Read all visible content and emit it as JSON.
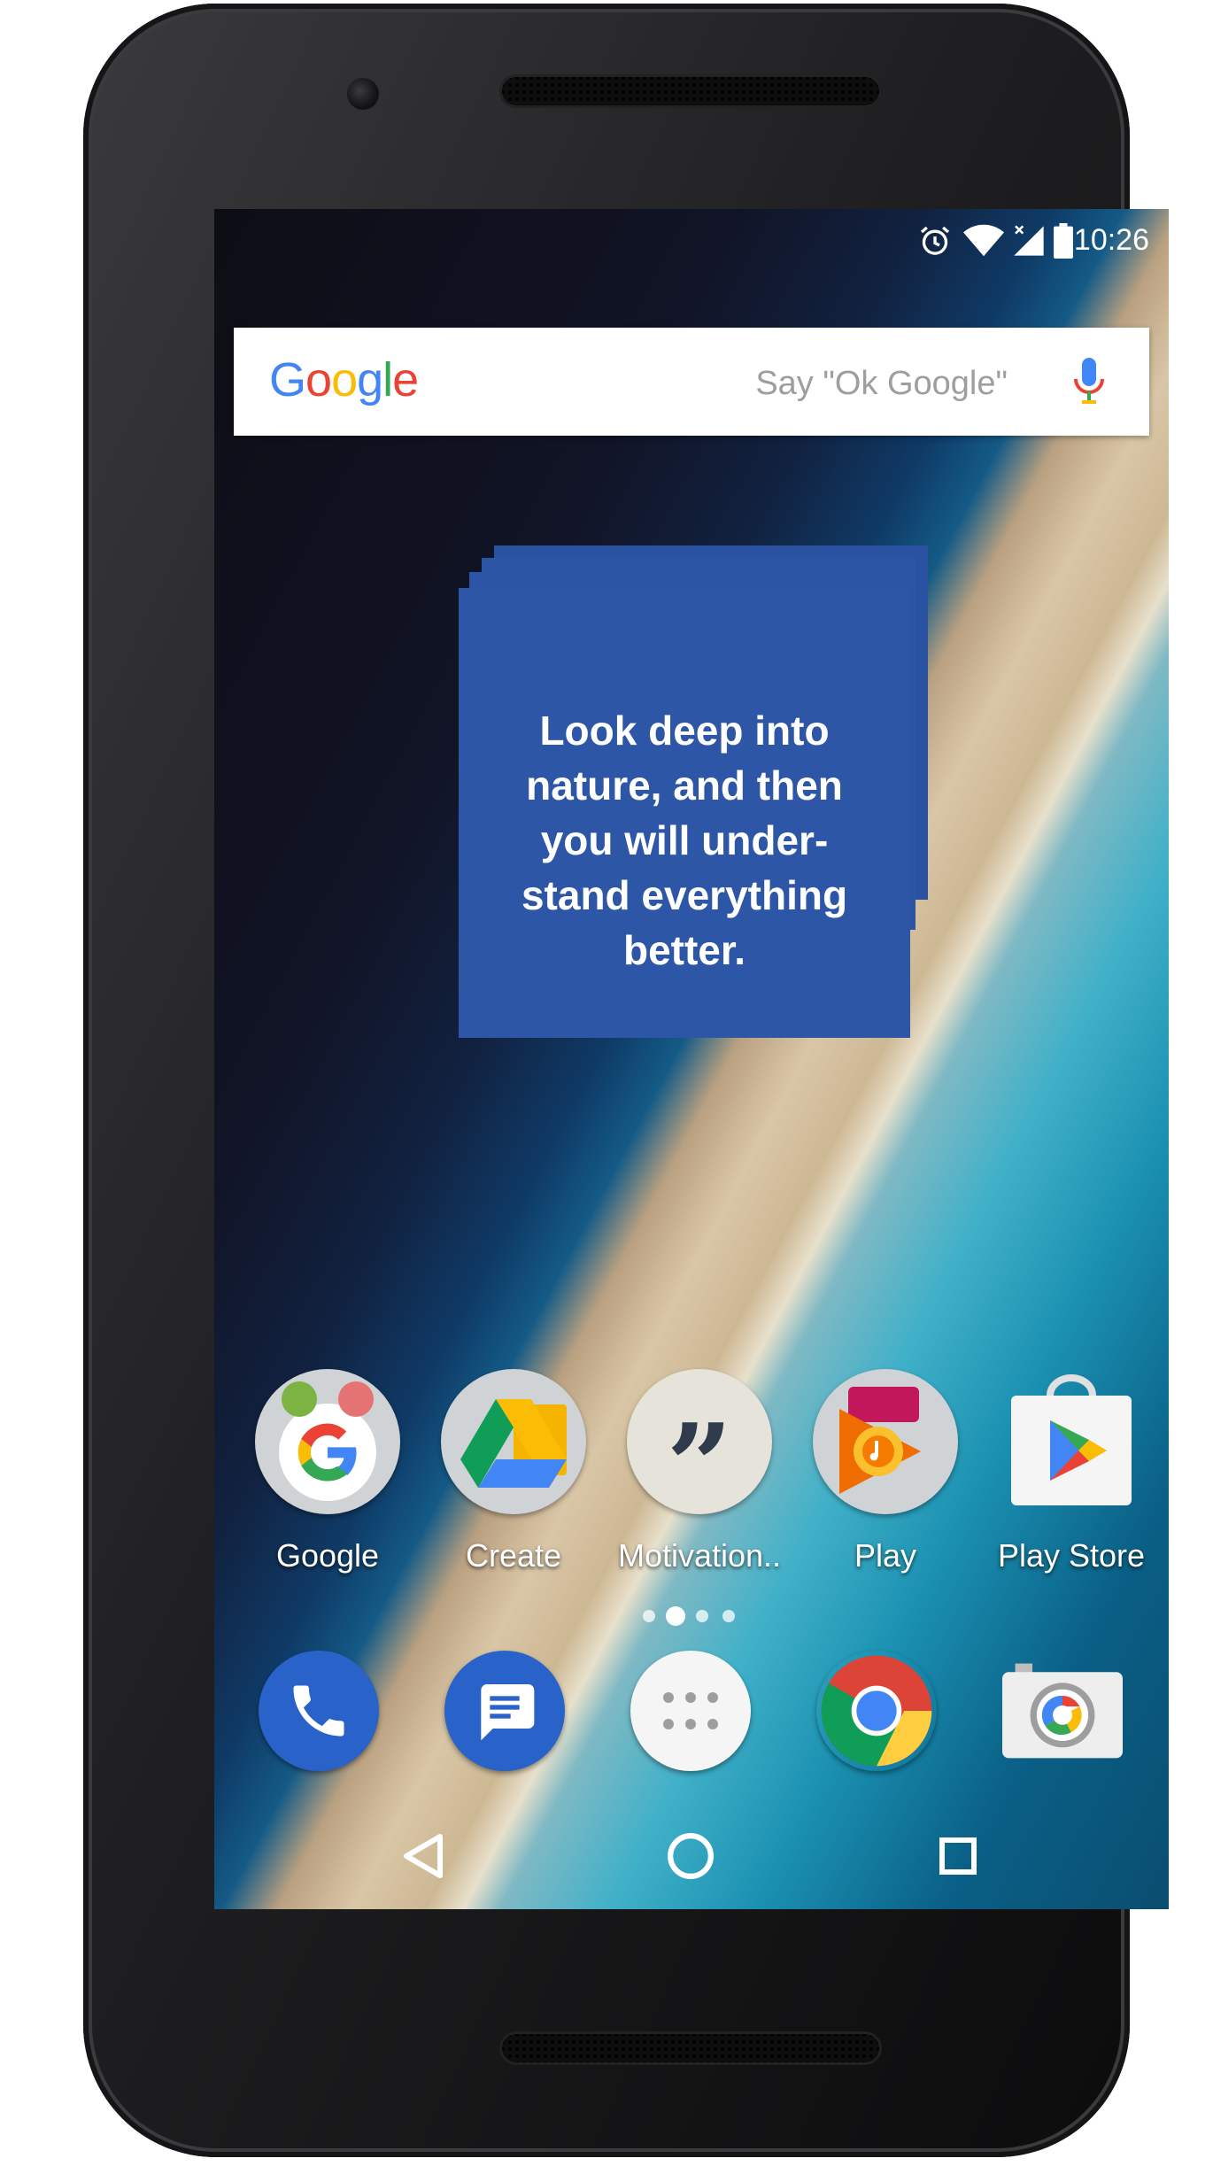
{
  "status_bar": {
    "time": "10:26",
    "icons": [
      "alarm-icon",
      "wifi-icon",
      "cell-signal-icon",
      "battery-icon"
    ]
  },
  "search": {
    "logo": "Google",
    "hint": "Say \"Ok Google\"",
    "mic_icon": "mic-icon"
  },
  "quote_widget": {
    "text": "Look deep into nature, and then you will under-stand everything better.",
    "color": "#2d56a6"
  },
  "home_apps": [
    {
      "label": "Google",
      "icon": "google-folder-icon"
    },
    {
      "label": "Create",
      "icon": "create-folder-icon"
    },
    {
      "label": "Motivation..",
      "icon": "quote-icon"
    },
    {
      "label": "Play",
      "icon": "play-folder-icon"
    },
    {
      "label": "Play Store",
      "icon": "play-store-icon"
    }
  ],
  "page_indicator": {
    "count": 4,
    "active": 1
  },
  "dock": [
    {
      "name": "phone",
      "icon": "phone-icon"
    },
    {
      "name": "messenger",
      "icon": "messages-icon"
    },
    {
      "name": "app-drawer",
      "icon": "apps-grid-icon"
    },
    {
      "name": "chrome",
      "icon": "chrome-icon"
    },
    {
      "name": "camera",
      "icon": "camera-icon"
    }
  ],
  "nav_bar": {
    "back": "back-icon",
    "home": "home-icon",
    "recents": "recents-icon"
  },
  "colors": {
    "google_blue": "#4285f4",
    "google_red": "#ea4335",
    "google_yellow": "#fbbc05",
    "google_green": "#34a853"
  }
}
